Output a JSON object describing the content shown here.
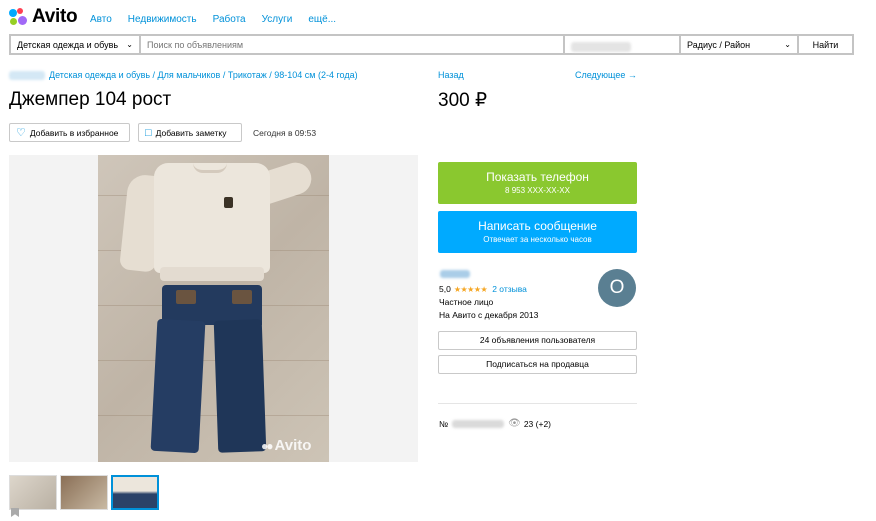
{
  "logo": {
    "text": "Avito"
  },
  "nav": {
    "items": [
      "Авто",
      "Недвижимость",
      "Работа",
      "Услуги",
      "ещё..."
    ]
  },
  "search": {
    "category": "Детская одежда и обувь",
    "placeholder": "Поиск по объявлениям",
    "radius": "Радиус / Район",
    "find_label": "Найти"
  },
  "breadcrumb": {
    "path": "Детская одежда и обувь / Для мальчиков / Трикотаж / 98-104 см (2-4 года)"
  },
  "nav_links": {
    "back": "Назад",
    "next": "Следующее →"
  },
  "listing": {
    "title": "Джемпер 104 рост",
    "price": "300 ₽",
    "favorite_label": "Добавить в избранное",
    "note_label": "Добавить заметку",
    "date": "Сегодня в 09:53",
    "watermark": "Avito",
    "thumbnail_count": 3
  },
  "contact": {
    "phone_label": "Показать телефон",
    "phone_masked": "8 953 XXX-XX-XX",
    "message_label": "Написать сообщение",
    "message_sub": "Отвечает за несколько часов"
  },
  "seller": {
    "rating": "5,0",
    "stars": "★★★★★",
    "reviews": "2 отзыва",
    "type": "Частное лицо",
    "since": "На Авито с декабря 2013",
    "avatar_letter": "O",
    "listings_button": "24 объявления пользователя",
    "subscribe_button": "Подписаться на продавца"
  },
  "ad_meta": {
    "number_prefix": "№",
    "views": "23 (+2)"
  },
  "colors": {
    "accent_blue": "#0091d9",
    "phone_green": "#8ac82f",
    "message_blue": "#00aaff",
    "star": "#f5a623"
  },
  "icons": [
    "heart-icon",
    "note-icon",
    "chevron-down-icon",
    "eye-icon",
    "bookmark-icon"
  ]
}
